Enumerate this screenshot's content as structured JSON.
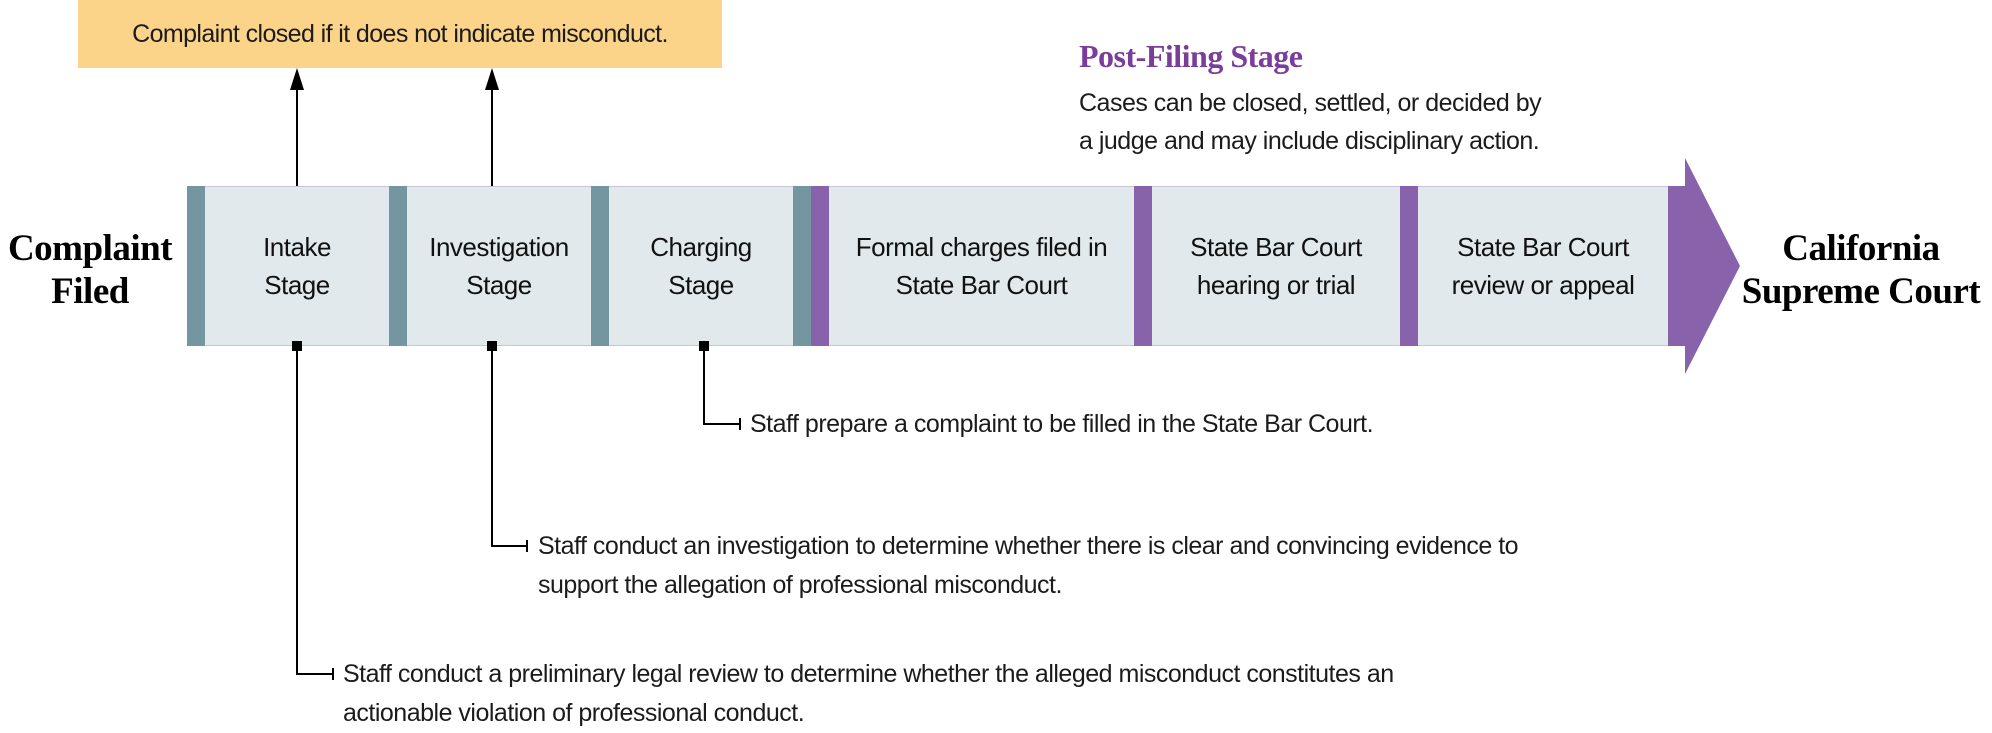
{
  "closed_note": "Complaint closed if it does not indicate misconduct.",
  "start_label": [
    "Complaint",
    "Filed"
  ],
  "end_label": [
    "California",
    "Supreme Court"
  ],
  "post_filing": {
    "title": "Post-Filing Stage",
    "description": [
      "Cases can be closed, settled, or decided by",
      "a judge and may include disciplinary action."
    ]
  },
  "stages": [
    {
      "line1": "Intake",
      "line2": "Stage",
      "group": "pre-filing"
    },
    {
      "line1": "Investigation",
      "line2": "Stage",
      "group": "pre-filing"
    },
    {
      "line1": "Charging",
      "line2": "Stage",
      "group": "pre-filing"
    },
    {
      "line1": "Formal charges filed in",
      "line2": "State Bar Court",
      "group": "post-filing"
    },
    {
      "line1": "State Bar Court",
      "line2": "hearing or trial",
      "group": "post-filing"
    },
    {
      "line1": "State Bar Court",
      "line2": "review or appeal",
      "group": "post-filing"
    }
  ],
  "stage_notes": {
    "charging": [
      "Staff prepare a complaint to be filled in the State Bar Court."
    ],
    "investigation": [
      "Staff conduct an investigation to determine whether there is clear and convincing evidence to",
      "support the allegation of professional misconduct."
    ],
    "intake": [
      "Staff conduct a preliminary legal review to determine whether the alleged misconduct constitutes an",
      "actionable violation of professional conduct."
    ]
  },
  "colors": {
    "closed_box": "#fbd48a",
    "stage_fill": "#e1e9ec",
    "pre_filing_separator": "#7496a0",
    "post_filing_separator": "#8862aa",
    "post_filing_title": "#7a3d9a",
    "arrow_head": "#8862aa"
  }
}
